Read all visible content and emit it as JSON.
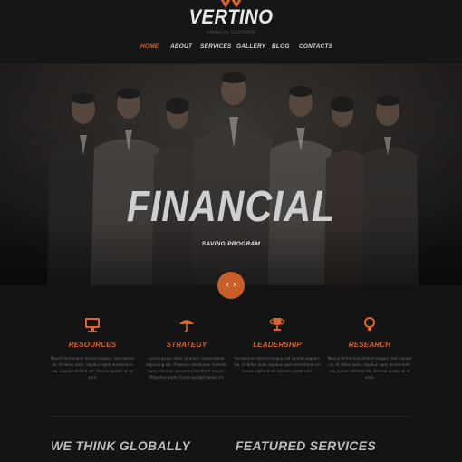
{
  "brand": {
    "name": "VERTINO",
    "tagline": "FINANCIAL SOLUTIONS"
  },
  "nav": {
    "items": [
      "HOME",
      "ABOUT",
      "SERVICES",
      "GALLERY",
      "BLOG",
      "CONTACTS"
    ],
    "active": "HOME"
  },
  "hero": {
    "title": "FINANCIAL",
    "subtitle": "SAVING PROGRAM",
    "button_icon": "chevrons-left-right-icon"
  },
  "features": [
    {
      "icon": "monitor-icon",
      "title": "RESOURCES",
      "text": "Mauris fermentum dictum magna. Sed laoreet ali. Ut tellus dolor, dapibus eget, elementum vel, cursus eleifend elit. Aenean auctor wi et urna."
    },
    {
      "icon": "umbrella-icon",
      "title": "STRATEGY",
      "text": "Lorem ipsum dolor sit amet, consectetuer adipiscing elit. Praesent vestibulum molestie lacus. Aenean nonummy hendrerit mauris. Phasellus porta. Fusce suscipit varius mi."
    },
    {
      "icon": "trophy-icon",
      "title": "LEADERSHIP",
      "text": "Fermentum dictum magna sed laoreet aliquam leo. Ut tellus dolor dapibus eget elementum vel cursus eleifend elit aenean auctor wisi."
    },
    {
      "icon": "lightbulb-icon",
      "title": "RESEARCH",
      "text": "Mauris fermentum dictum magna. Sed laoreet ali. Ut tellus dolor, dapibus eget, elementum vel, cursus eleifend elit. Aenean auctor wi et urna."
    }
  ],
  "sections": {
    "left": "WE THINK GLOBALLY",
    "right": "FEATURED SERVICES"
  },
  "colors": {
    "accent": "#d9652d",
    "background": "#141414",
    "header": "#161616"
  }
}
